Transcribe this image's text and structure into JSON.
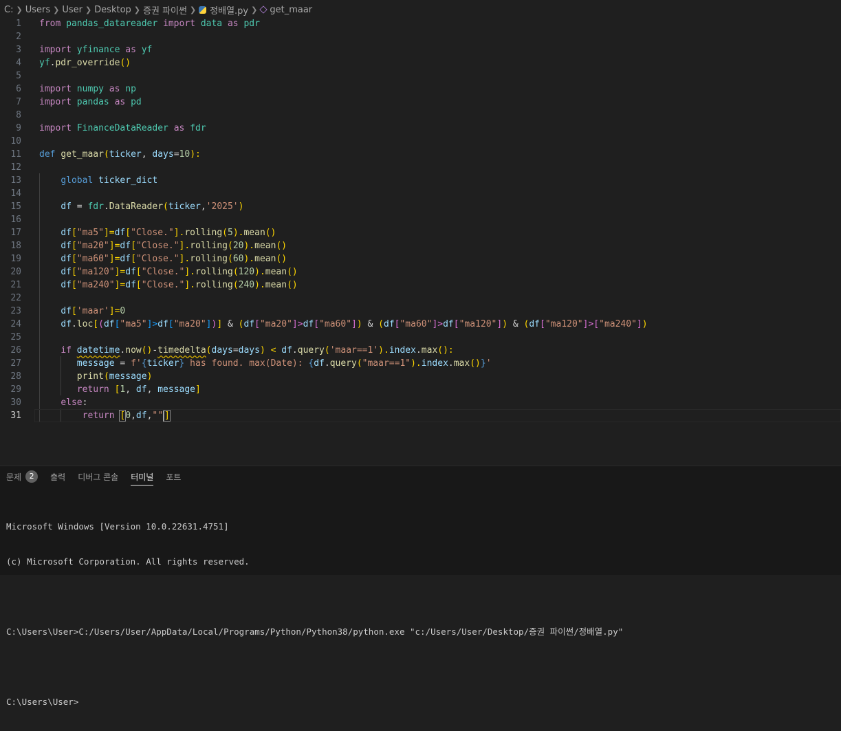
{
  "breadcrumb": {
    "items": [
      "C:",
      "Users",
      "User",
      "Desktop",
      "증권 파이썬",
      "정배열.py",
      "get_maar"
    ]
  },
  "editor": {
    "active_line": 31,
    "line_numbers": [
      "1",
      "2",
      "3",
      "4",
      "5",
      "6",
      "7",
      "8",
      "9",
      "10",
      "11",
      "12",
      "13",
      "14",
      "15",
      "16",
      "17",
      "18",
      "19",
      "20",
      "21",
      "22",
      "23",
      "24",
      "25",
      "26",
      "27",
      "28",
      "29",
      "30",
      "31"
    ]
  },
  "code": {
    "l1": [
      "from",
      " ",
      "pandas_datareader",
      " ",
      "import",
      " ",
      "data",
      " ",
      "as",
      " ",
      "pdr"
    ],
    "l3": [
      "import",
      " ",
      "yfinance",
      " ",
      "as",
      " ",
      "yf"
    ],
    "l4": [
      "yf",
      ".",
      "pdr_override",
      "(",
      ")"
    ],
    "l6": [
      "import",
      " ",
      "numpy",
      " ",
      "as",
      " ",
      "np"
    ],
    "l7": [
      "import",
      " ",
      "pandas",
      " ",
      "as",
      " ",
      "pd"
    ],
    "l9": [
      "import",
      " ",
      "FinanceDataReader",
      " ",
      "as",
      " ",
      "fdr"
    ],
    "l11": [
      "def",
      " ",
      "get_maar",
      "(",
      "ticker",
      ", ",
      "days",
      "=",
      "10",
      "):"
    ],
    "l13": [
      "    ",
      "global",
      " ",
      "ticker_dict"
    ],
    "l15": [
      "    ",
      "df",
      " = ",
      "fdr",
      ".",
      "DataReader",
      "(",
      "ticker",
      ",",
      "'2025'",
      ")"
    ],
    "l17": [
      "    ",
      "df",
      "[",
      "\"ma5\"",
      "]=",
      "df",
      "[",
      "\"Close.\"",
      "].",
      "rolling",
      "(",
      "5",
      ").",
      "mean",
      "()"
    ],
    "l18": [
      "    ",
      "df",
      "[",
      "\"ma20\"",
      "]=",
      "df",
      "[",
      "\"Close.\"",
      "].",
      "rolling",
      "(",
      "20",
      ").",
      "mean",
      "()"
    ],
    "l19": [
      "    ",
      "df",
      "[",
      "\"ma60\"",
      "]=",
      "df",
      "[",
      "\"Close.\"",
      "].",
      "rolling",
      "(",
      "60",
      ").",
      "mean",
      "()"
    ],
    "l20": [
      "    ",
      "df",
      "[",
      "\"ma120\"",
      "]=",
      "df",
      "[",
      "\"Close.\"",
      "].",
      "rolling",
      "(",
      "120",
      ").",
      "mean",
      "()"
    ],
    "l21": [
      "    ",
      "df",
      "[",
      "\"ma240\"",
      "]=",
      "df",
      "[",
      "\"Close.\"",
      "].",
      "rolling",
      "(",
      "240",
      ").",
      "mean",
      "()"
    ],
    "l23": [
      "    ",
      "df",
      "[",
      "'maar'",
      "]=",
      "0"
    ],
    "l24": [
      "    ",
      "df",
      ".",
      "loc",
      "[",
      "(",
      "df",
      "[",
      "\"ma5\"",
      "]>",
      "df",
      "[",
      "\"ma20\"",
      "]",
      ")",
      "]",
      " & ",
      "(",
      "df",
      "[",
      "\"ma20\"",
      "]>",
      "df",
      "[",
      "\"ma60\"",
      "]",
      ")",
      " & ",
      "(",
      "df",
      "[",
      "\"ma60\"",
      "]>",
      "df",
      "[",
      "\"ma120\"",
      "]",
      ")",
      " & ",
      "(",
      "df",
      "[",
      "\"ma120\"",
      "]>",
      "[",
      "\"ma240\"",
      "]",
      ")"
    ],
    "l26": [
      "    ",
      "if",
      " ",
      "datetime",
      ".",
      "now",
      "()",
      "-",
      "timedelta",
      "(",
      "days",
      "=",
      "days",
      ") < ",
      "df",
      ".",
      "query",
      "(",
      "'maar==1'",
      ").",
      "index",
      ".",
      "max",
      "():"
    ],
    "l27": [
      "       ",
      "message",
      " = ",
      "f'",
      "{",
      "ticker",
      "}",
      " has found. max(Date): ",
      "{",
      "df",
      ".",
      "query",
      "(",
      "\"maar==1\"",
      ").",
      "index",
      ".",
      "max",
      "()",
      "}",
      "'"
    ],
    "l28": [
      "       ",
      "print",
      "(",
      "message",
      ")"
    ],
    "l29": [
      "       ",
      "return",
      " ",
      "[",
      "1",
      ", ",
      "df",
      ", ",
      "message",
      "]"
    ],
    "l30": [
      "    ",
      "else",
      ":"
    ],
    "l31": [
      "        ",
      "return",
      " ",
      "[",
      "0",
      ",",
      "df",
      ",",
      "\"\"",
      "]"
    ]
  },
  "panel": {
    "tabs": [
      {
        "label": "문제",
        "badge": "2"
      },
      {
        "label": "출력"
      },
      {
        "label": "디버그 콘솔"
      },
      {
        "label": "터미널",
        "active": true
      },
      {
        "label": "포트"
      }
    ],
    "terminal_lines": [
      "Microsoft Windows [Version 10.0.22631.4751]",
      "(c) Microsoft Corporation. All rights reserved.",
      "",
      "C:\\Users\\User>C:/Users/User/AppData/Local/Programs/Python/Python38/python.exe \"c:/Users/User/Desktop/증권 파이썬/정배열.py\"",
      "",
      "C:\\Users\\User>"
    ]
  }
}
